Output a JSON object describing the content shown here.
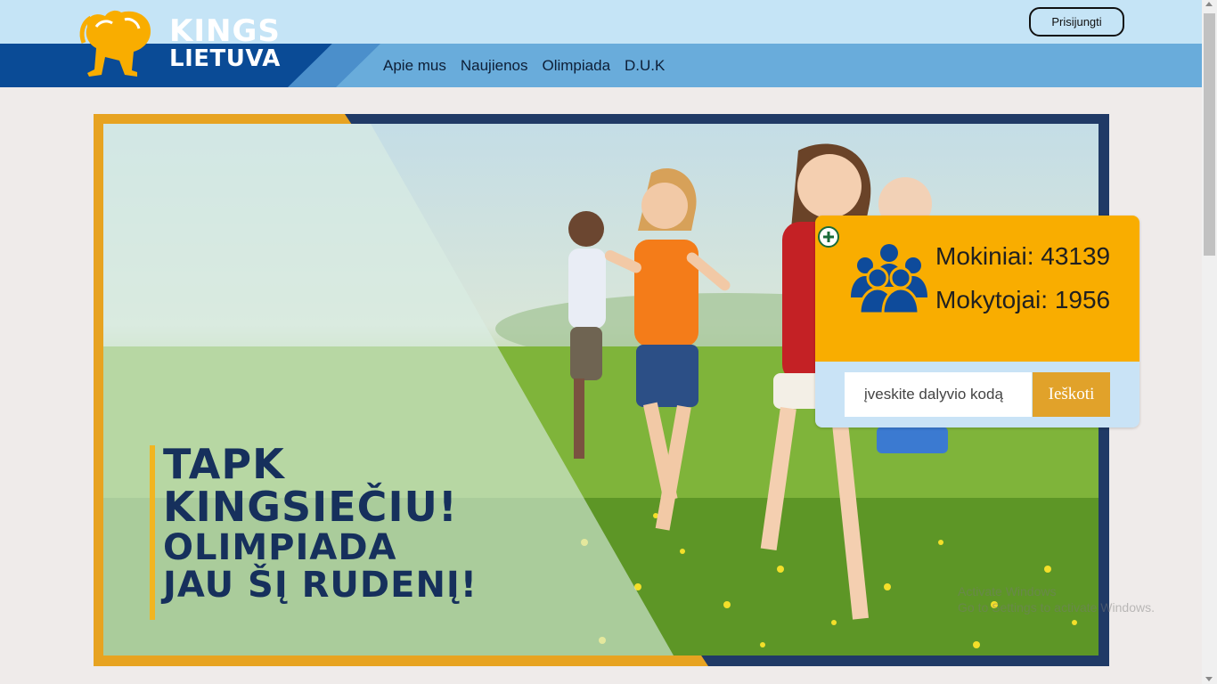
{
  "header": {
    "logo_line1": "KINGS",
    "logo_line2": "LIETUVA",
    "login_label": "Prisijungti",
    "nav": [
      {
        "label": "Apie mus"
      },
      {
        "label": "Naujienos"
      },
      {
        "label": "Olimpiada"
      },
      {
        "label": "D.U.K"
      }
    ]
  },
  "hero": {
    "line1": "TAPK",
    "line2": "KINGSIEČIU!",
    "line3": "OLIMPIADA",
    "line4": "JAU ŠĮ RUDENĮ!"
  },
  "stats": {
    "students": "Mokiniai: 43139",
    "teachers": "Mokytojai: 1956",
    "code_placeholder": "įveskite dalyvio kodą",
    "search_label": "Ieškoti"
  },
  "watermark": {
    "line1": "Activate Windows",
    "line2": "Go to Settings to activate Windows."
  },
  "colors": {
    "brand_dark": "#0a4b96",
    "nav_light": "#69acdb",
    "accent_orange": "#f9ad00",
    "frame_navy": "#203a66",
    "frame_gold": "#e7a321",
    "headline_navy": "#16305c"
  },
  "icons": {
    "logo": "lion-icon",
    "plus": "plus-circle-icon",
    "people": "people-group-icon"
  }
}
